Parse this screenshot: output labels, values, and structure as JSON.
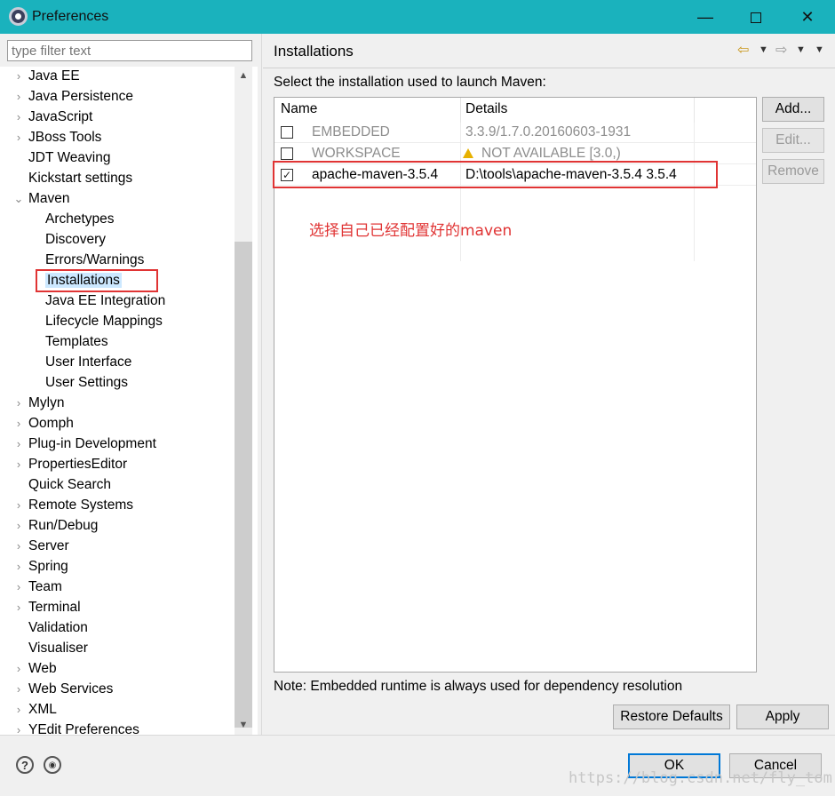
{
  "window": {
    "title": "Preferences",
    "minimize": "—",
    "close": "✕"
  },
  "sidebar": {
    "filter_placeholder": "type filter text",
    "items": [
      {
        "label": "Java EE",
        "chevron": "›"
      },
      {
        "label": "Java Persistence",
        "chevron": "›"
      },
      {
        "label": "JavaScript",
        "chevron": "›"
      },
      {
        "label": "JBoss Tools",
        "chevron": "›"
      },
      {
        "label": "JDT Weaving",
        "chevron": ""
      },
      {
        "label": "Kickstart settings",
        "chevron": ""
      },
      {
        "label": "Maven",
        "chevron": "⌄"
      },
      {
        "label": "Archetypes"
      },
      {
        "label": "Discovery"
      },
      {
        "label": "Errors/Warnings"
      },
      {
        "label": "Installations"
      },
      {
        "label": "Java EE Integration"
      },
      {
        "label": "Lifecycle Mappings"
      },
      {
        "label": "Templates"
      },
      {
        "label": "User Interface"
      },
      {
        "label": "User Settings"
      },
      {
        "label": "Mylyn",
        "chevron": "›"
      },
      {
        "label": "Oomph",
        "chevron": "›"
      },
      {
        "label": "Plug-in Development",
        "chevron": "›"
      },
      {
        "label": "PropertiesEditor",
        "chevron": "›"
      },
      {
        "label": "Quick Search",
        "chevron": ""
      },
      {
        "label": "Remote Systems",
        "chevron": "›"
      },
      {
        "label": "Run/Debug",
        "chevron": "›"
      },
      {
        "label": "Server",
        "chevron": "›"
      },
      {
        "label": "Spring",
        "chevron": "›"
      },
      {
        "label": "Team",
        "chevron": "›"
      },
      {
        "label": "Terminal",
        "chevron": "›"
      },
      {
        "label": "Validation",
        "chevron": ""
      },
      {
        "label": "Visualiser",
        "chevron": ""
      },
      {
        "label": "Web",
        "chevron": "›"
      },
      {
        "label": "Web Services",
        "chevron": "›"
      },
      {
        "label": "XML",
        "chevron": "›"
      },
      {
        "label": "YEdit Preferences",
        "chevron": "›"
      }
    ],
    "scroll_up": "▲",
    "scroll_down": "▼"
  },
  "page": {
    "title": "Installations",
    "nav_back": "⇦",
    "nav_forward": "⇨",
    "nav_dropdown": "▼",
    "description": "Select the installation used to launch Maven:",
    "table": {
      "headers": [
        "Name",
        "Details"
      ],
      "rows": [
        {
          "check": "",
          "name": "EMBEDDED",
          "details": "3.3.9/1.7.0.20160603-1931"
        },
        {
          "check": "",
          "name": "WORKSPACE",
          "details": "NOT AVAILABLE [3.0,)"
        },
        {
          "check": "✓",
          "name": "apache-maven-3.5.4",
          "details": "D:\\tools\\apache-maven-3.5.4 3.5.4"
        }
      ]
    },
    "annotation": "选择自己已经配置好的maven",
    "buttons": {
      "add": "Add...",
      "edit": "Edit...",
      "remove": "Remove"
    },
    "note": "Note: Embedded runtime is always used for dependency resolution",
    "restore_defaults": "Restore Defaults",
    "apply": "Apply"
  },
  "footer": {
    "help_icon": "?",
    "import_icon": "◉",
    "ok": "OK",
    "cancel": "Cancel",
    "watermark": "https://blog.csdn.net/fly_tom"
  }
}
